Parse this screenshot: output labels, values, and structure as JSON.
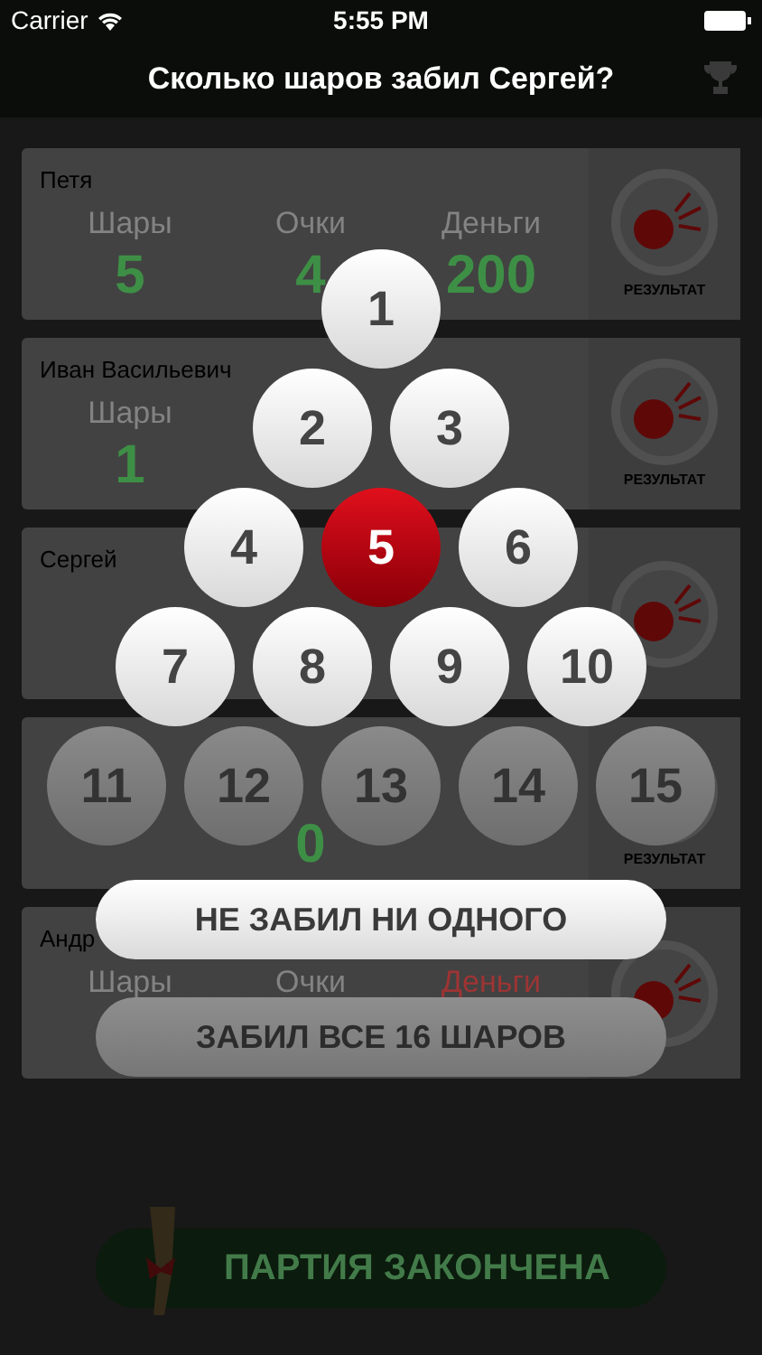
{
  "status_bar": {
    "carrier": "Carrier",
    "time": "5:55 PM"
  },
  "nav": {
    "title": "Сколько шаров забил Сергей?"
  },
  "players": [
    {
      "name": "Петя",
      "stats": [
        {
          "kind": "balls",
          "label": "Шары",
          "value": "5",
          "negative": false
        },
        {
          "kind": "points",
          "label": "Очки",
          "value": "4",
          "negative": false
        },
        {
          "kind": "money",
          "label": "Деньги",
          "value": "200",
          "negative": false
        }
      ],
      "result_label": "РЕЗУЛЬТАТ"
    },
    {
      "name": "Иван Васильевич",
      "stats": [
        {
          "kind": "balls",
          "label": "Шары",
          "value": "1",
          "negative": false
        }
      ],
      "result_label": "РЕЗУЛЬТАТ"
    },
    {
      "name": "Сергей"
    },
    {
      "stats": [
        {
          "kind": "points",
          "value": "0",
          "negative": false
        }
      ],
      "result_label": "РЕЗУЛЬТАТ"
    },
    {
      "name": "Андр",
      "stats": [
        {
          "kind": "balls",
          "label": "Шары",
          "negative": false
        },
        {
          "kind": "points",
          "label": "Очки",
          "negative": false
        },
        {
          "kind": "money",
          "label": "Деньги",
          "negative": true
        }
      ]
    }
  ],
  "picker": {
    "balls": [
      {
        "label": "1",
        "selected": false,
        "disabled": false
      },
      {
        "label": "2",
        "selected": false,
        "disabled": false
      },
      {
        "label": "3",
        "selected": false,
        "disabled": false
      },
      {
        "label": "4",
        "selected": false,
        "disabled": false
      },
      {
        "label": "5",
        "selected": true,
        "disabled": false
      },
      {
        "label": "6",
        "selected": false,
        "disabled": false
      },
      {
        "label": "7",
        "selected": false,
        "disabled": false
      },
      {
        "label": "8",
        "selected": false,
        "disabled": false
      },
      {
        "label": "9",
        "selected": false,
        "disabled": false
      },
      {
        "label": "10",
        "selected": false,
        "disabled": false
      },
      {
        "label": "11",
        "selected": false,
        "disabled": true
      },
      {
        "label": "12",
        "selected": false,
        "disabled": true
      },
      {
        "label": "13",
        "selected": false,
        "disabled": true
      },
      {
        "label": "14",
        "selected": false,
        "disabled": true
      },
      {
        "label": "15",
        "selected": false,
        "disabled": true
      }
    ],
    "buttons": [
      {
        "label": "НЕ ЗАБИЛ НИ ОДНОГО",
        "disabled": false
      },
      {
        "label": "ЗАБИЛ ВСЕ 16 ШАРОВ",
        "disabled": true
      }
    ]
  },
  "finish_button": {
    "label": "ПАРТИЯ ЗАКОНЧЕНА"
  }
}
